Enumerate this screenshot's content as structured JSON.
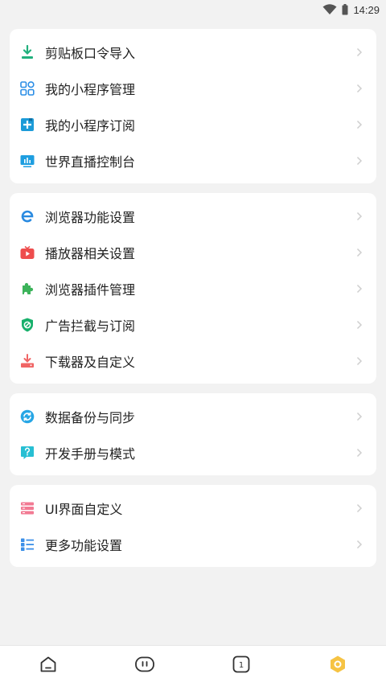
{
  "status": {
    "time": "14:29"
  },
  "colors": {
    "background": "#f2f2f2",
    "card": "#ffffff",
    "accent": "#f6c343"
  },
  "groups": [
    {
      "items": [
        {
          "label": "剪贴板口令导入",
          "icon": "clipboard-import-icon"
        },
        {
          "label": "我的小程序管理",
          "icon": "mini-program-grid-icon"
        },
        {
          "label": "我的小程序订阅",
          "icon": "mini-program-subscribe-icon"
        },
        {
          "label": "世界直播控制台",
          "icon": "live-console-icon"
        }
      ]
    },
    {
      "items": [
        {
          "label": "浏览器功能设置",
          "icon": "browser-e-icon"
        },
        {
          "label": "播放器相关设置",
          "icon": "player-icon"
        },
        {
          "label": "浏览器插件管理",
          "icon": "puzzle-plugin-icon"
        },
        {
          "label": "广告拦截与订阅",
          "icon": "ad-block-shield-icon"
        },
        {
          "label": "下载器及自定义",
          "icon": "downloader-icon"
        }
      ]
    },
    {
      "items": [
        {
          "label": "数据备份与同步",
          "icon": "cloud-sync-icon"
        },
        {
          "label": "开发手册与模式",
          "icon": "help-manual-icon"
        }
      ]
    },
    {
      "items": [
        {
          "label": "UI界面自定义",
          "icon": "ui-customize-icon"
        },
        {
          "label": "更多功能设置",
          "icon": "more-settings-icon"
        }
      ]
    }
  ],
  "bottom_nav": {
    "tabs": [
      {
        "name": "home-icon"
      },
      {
        "name": "app-icon"
      },
      {
        "name": "tabs-count-icon",
        "count": "1"
      },
      {
        "name": "settings-icon"
      }
    ]
  }
}
